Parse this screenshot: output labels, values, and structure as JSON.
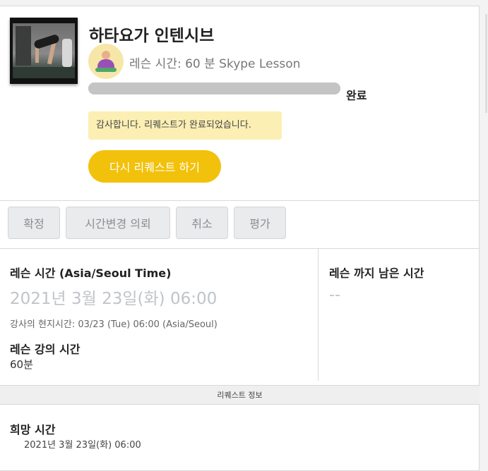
{
  "lesson": {
    "title": "하타요가 인텐시브",
    "meta": "레슨 시간: 60 분 Skype Lesson",
    "progress_fraction": 1.0,
    "status": "완료"
  },
  "notice": "감사합니다. 리퀘스트가 완료되었습니다.",
  "rerequest_label": "다시 리퀘스트 하기",
  "actions": {
    "confirm": "확정",
    "change_time": "시간변경 의뢰",
    "cancel": "취소",
    "review": "평가"
  },
  "schedule": {
    "time_heading": "레슨 시간 (Asia/Seoul Time)",
    "date": "2021년 3월 23일(화) 06:00",
    "teacher_local": "강사의 현지시간: 03/23 (Tue) 06:00 (Asia/Seoul)",
    "duration_heading": "레슨 강의 시간",
    "duration": "60분",
    "remaining_heading": "레슨 까지 남은 시간",
    "remaining": "--"
  },
  "request_info": {
    "section_title": "리퀘스트 정보",
    "preferred_heading": "희망 시간",
    "preferred_date": "2021년 3월 23일(화) 06:00"
  },
  "colors": {
    "accent": "#f2c10b",
    "notice_bg": "#fcefb4",
    "progress": "#c4c4c4"
  }
}
